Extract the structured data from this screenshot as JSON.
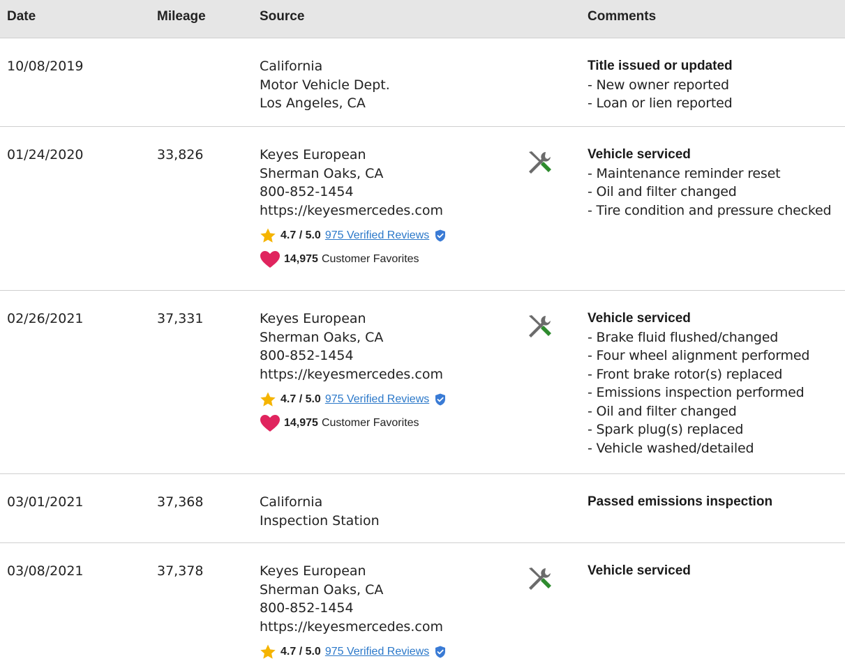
{
  "header": {
    "date": "Date",
    "mileage": "Mileage",
    "source": "Source",
    "comments": "Comments"
  },
  "rows": [
    {
      "date": "10/08/2019",
      "mileage": "",
      "source": [
        "California",
        "Motor Vehicle Dept.",
        "Los Angeles, CA"
      ],
      "comment_title": "Title issued or updated",
      "comments": [
        "- New owner reported",
        "- Loan or lien reported"
      ]
    },
    {
      "date": "01/24/2020",
      "mileage": "33,826",
      "source": [
        "Keyes European",
        "Sherman Oaks, CA",
        "800-852-1454",
        "https://keyesmercedes.com"
      ],
      "rating": "4.7 / 5.0",
      "reviews": "975 Verified Reviews",
      "favorites_count": "14,975",
      "favorites_label": "Customer Favorites",
      "comment_title": "Vehicle serviced",
      "comments": [
        "- Maintenance reminder reset",
        "- Oil and filter changed",
        "- Tire condition and pressure checked"
      ]
    },
    {
      "date": "02/26/2021",
      "mileage": "37,331",
      "source": [
        "Keyes European",
        "Sherman Oaks, CA",
        "800-852-1454",
        "https://keyesmercedes.com"
      ],
      "rating": "4.7 / 5.0",
      "reviews": "975 Verified Reviews",
      "favorites_count": "14,975",
      "favorites_label": "Customer Favorites",
      "comment_title": "Vehicle serviced",
      "comments": [
        "- Brake fluid flushed/changed",
        "- Four wheel alignment performed",
        "- Front brake rotor(s) replaced",
        "- Emissions inspection performed",
        "- Oil and filter changed",
        "- Spark plug(s) replaced",
        "- Vehicle washed/detailed"
      ]
    },
    {
      "date": "03/01/2021",
      "mileage": "37,368",
      "source": [
        "California",
        "Inspection Station"
      ],
      "comment_title": "Passed emissions inspection",
      "comments": []
    },
    {
      "date": "03/08/2021",
      "mileage": "37,378",
      "source": [
        "Keyes European",
        "Sherman Oaks, CA",
        "800-852-1454",
        "https://keyesmercedes.com"
      ],
      "rating": "4.7 / 5.0",
      "reviews": "975 Verified Reviews",
      "comment_title": "Vehicle serviced",
      "comments": []
    }
  ],
  "colors": {
    "header_bg": "#e6e6e6",
    "link": "#2b78c9",
    "star": "#f5b400",
    "heart": "#e0245e",
    "verified": "#3a7bd5",
    "icon_gray": "#6b6b6b",
    "icon_green": "#2e8b2e"
  },
  "icons": {
    "service": "wrench-screwdriver-icon",
    "star": "star-icon",
    "verified": "verified-shield-icon",
    "heart": "heart-icon"
  }
}
